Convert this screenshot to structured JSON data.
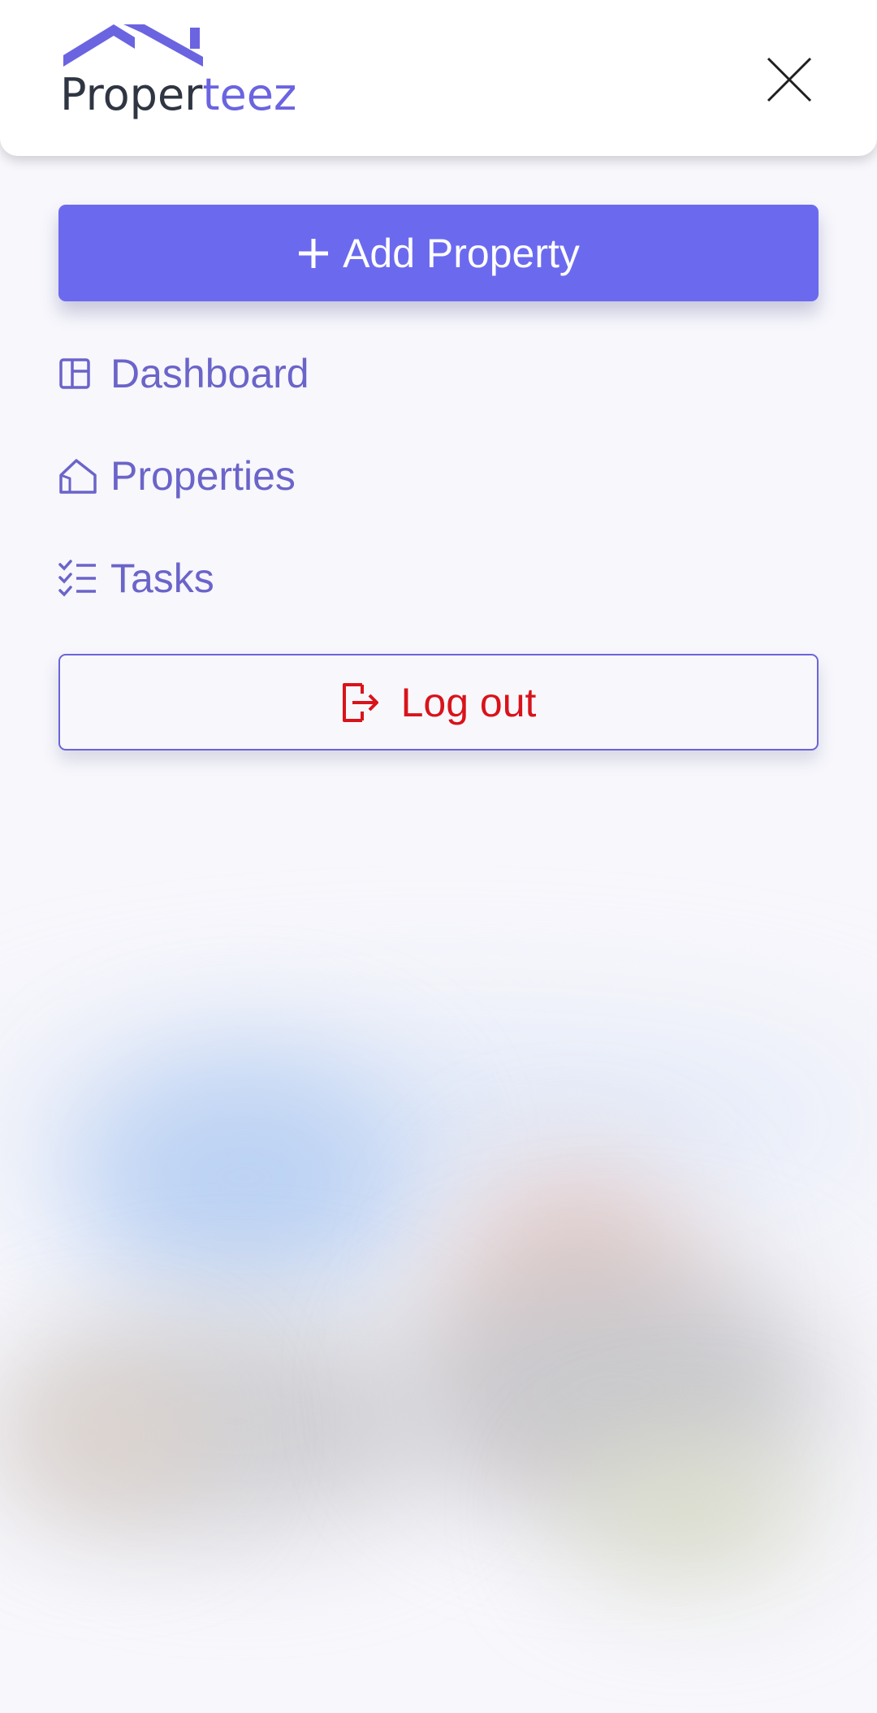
{
  "brand": {
    "name_dark": "Proper",
    "name_accent": "teez",
    "accent_color": "#6b64e0",
    "dark_color": "#2f3542"
  },
  "header": {
    "close_icon": "close-icon"
  },
  "menu": {
    "add_property": {
      "label": "Add Property",
      "icon": "plus-icon",
      "color": "#6b6aef"
    },
    "items": [
      {
        "label": "Dashboard",
        "icon": "dashboard-icon"
      },
      {
        "label": "Properties",
        "icon": "house-icon"
      },
      {
        "label": "Tasks",
        "icon": "checklist-icon"
      }
    ],
    "item_color": "#6b64c9",
    "logout": {
      "label": "Log out",
      "icon": "logout-icon",
      "color": "#d9131b"
    }
  }
}
